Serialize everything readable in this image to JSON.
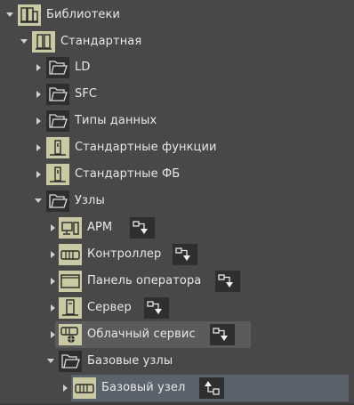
{
  "tree": {
    "root": {
      "label": "Библиотеки"
    },
    "standard": {
      "label": "Стандартная"
    },
    "ld": {
      "label": "LD"
    },
    "sfc": {
      "label": "SFC"
    },
    "datatypes": {
      "label": "Типы данных"
    },
    "std_functions": {
      "label": "Стандартные функции"
    },
    "std_fb": {
      "label": "Стандартные ФБ"
    },
    "nodes": {
      "label": "Узлы"
    },
    "arm": {
      "label": "АРМ"
    },
    "controller": {
      "label": "Контроллер"
    },
    "operator_panel": {
      "label": "Панель оператора"
    },
    "server": {
      "label": "Сервер"
    },
    "cloud_service": {
      "label": "Облачный сервис"
    },
    "base_nodes": {
      "label": "Базовые узлы"
    },
    "base_node": {
      "label": "Базовый узел"
    }
  },
  "colors": {
    "background": "#484848",
    "icon_highlight": "#c9c9a3",
    "selection_blue": "#5a636b",
    "hover_gray": "#5b5b5b"
  }
}
